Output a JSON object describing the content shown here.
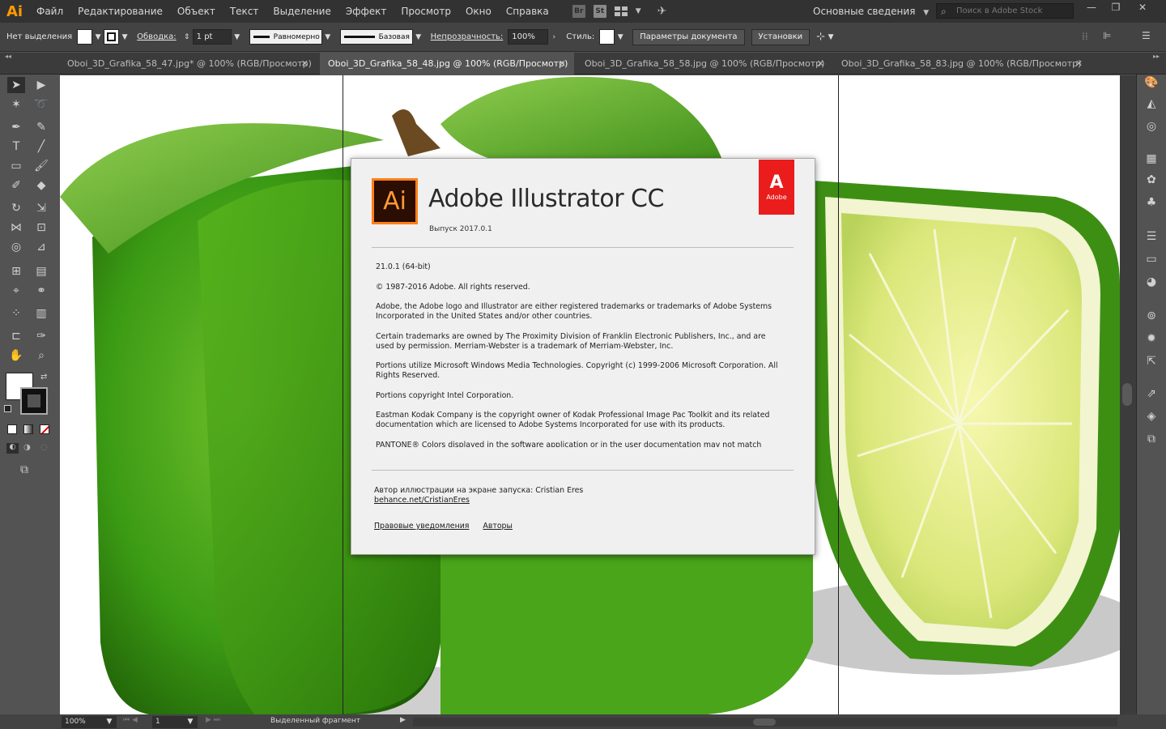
{
  "app": {
    "logo": "Ai"
  },
  "menu": [
    "Файл",
    "Редактирование",
    "Объект",
    "Текст",
    "Выделение",
    "Эффект",
    "Просмотр",
    "Окно",
    "Справка"
  ],
  "menubar_badges": {
    "bridge": "Br",
    "stock": "St"
  },
  "workspace": "Основные сведения",
  "stock_search_placeholder": "Поиск в Adobe Stock",
  "window_controls": {
    "minimize": "—",
    "restore": "❐",
    "close": "✕"
  },
  "control_bar": {
    "selection_label": "Нет выделения",
    "stroke_label": "Обводка:",
    "stroke_weight": "1 pt",
    "profile_uniform": "Равномерно",
    "brush_basic": "Базовая",
    "opacity_label": "Непрозрачность:",
    "opacity_value": "100%",
    "style_label": "Стиль:",
    "doc_setup_button": "Параметры документа",
    "prefs_button": "Установки"
  },
  "tabs": [
    {
      "title": "Oboi_3D_Grafika_58_47.jpg* @ 100% (RGB/Просмотр)",
      "active": false
    },
    {
      "title": "Oboi_3D_Grafika_58_48.jpg @ 100% (RGB/Просмотр)",
      "active": true
    },
    {
      "title": "Oboi_3D_Grafika_58_58.jpg @ 100% (RGB/Просмотр)",
      "active": false
    },
    {
      "title": "Oboi_3D_Grafika_58_83.jpg @ 100% (RGB/Просмотр)",
      "active": false
    }
  ],
  "about": {
    "logo_text": "Ai",
    "product": "Adobe Illustrator CC",
    "release": "Выпуск 2017.0.1",
    "adobe_mark": "A",
    "adobe_word": "Adobe",
    "legal": [
      "21.0.1 (64-bit)",
      "© 1987-2016 Adobe. All rights reserved.",
      "Adobe, the Adobe logo and Illustrator are either registered trademarks or trademarks of Adobe Systems Incorporated in the United States and/or other countries.",
      "Certain trademarks are owned by The Proximity Division of Franklin Electronic Publishers, Inc., and are used by permission. Merriam-Webster is a trademark of Merriam-Webster, Inc.",
      "Portions utilize Microsoft Windows Media Technologies. Copyright (c) 1999-2006 Microsoft Corporation. All Rights Reserved.",
      "Portions copyright Intel Corporation.",
      "Eastman Kodak Company is the copyright owner of Kodak Professional Image Pac Toolkit and its related documentation which are licensed to Adobe Systems Incorporated for use with its products.",
      "PANTONE® Colors displayed in the software application or in the user documentation may not match"
    ],
    "splash_credit": "Автор иллюстрации на экране запуска: Cristian Eres",
    "splash_link": "behance.net/CristianEres",
    "legal_link": "Правовые уведомления",
    "authors_link": "Авторы"
  },
  "status": {
    "zoom": "100%",
    "page": "1",
    "tool_status": "Выделенный фрагмент"
  }
}
